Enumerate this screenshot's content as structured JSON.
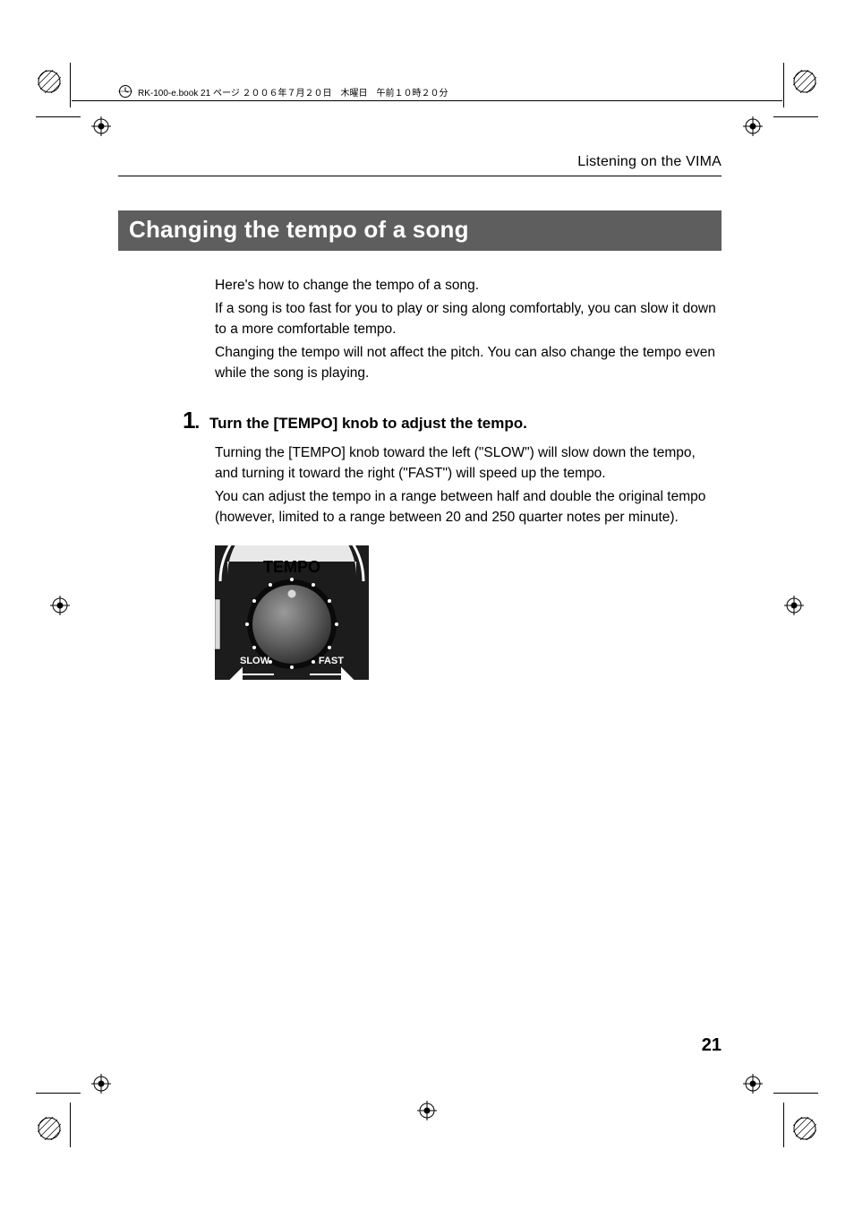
{
  "book_header": "RK-100-e.book  21 ページ  ２００６年７月２０日　木曜日　午前１０時２０分",
  "running_head": "Listening on the VIMA",
  "section_title": "Changing the tempo of a song",
  "intro": {
    "p1": "Here's how to change the tempo of a song.",
    "p2": "If a song is too fast for you to play or sing along comfortably, you can slow it down to a more comfortable tempo.",
    "p3": "Changing the tempo will not affect the pitch. You can also change the tempo even while the song is playing."
  },
  "step1": {
    "num": "1",
    "dot": ".",
    "title": "Turn the [TEMPO] knob to adjust the tempo.",
    "p1": "Turning the [TEMPO] knob toward the left (\"SLOW\") will slow down the tempo, and turning it toward the right (\"FAST\") will speed up the tempo.",
    "p2": "You can adjust the tempo in a range between half and double the original tempo (however, limited to a range between 20 and 250 quarter notes per minute)."
  },
  "knob": {
    "label": "TEMPO",
    "slow": "SLOW",
    "fast": "FAST"
  },
  "page_number": "21"
}
